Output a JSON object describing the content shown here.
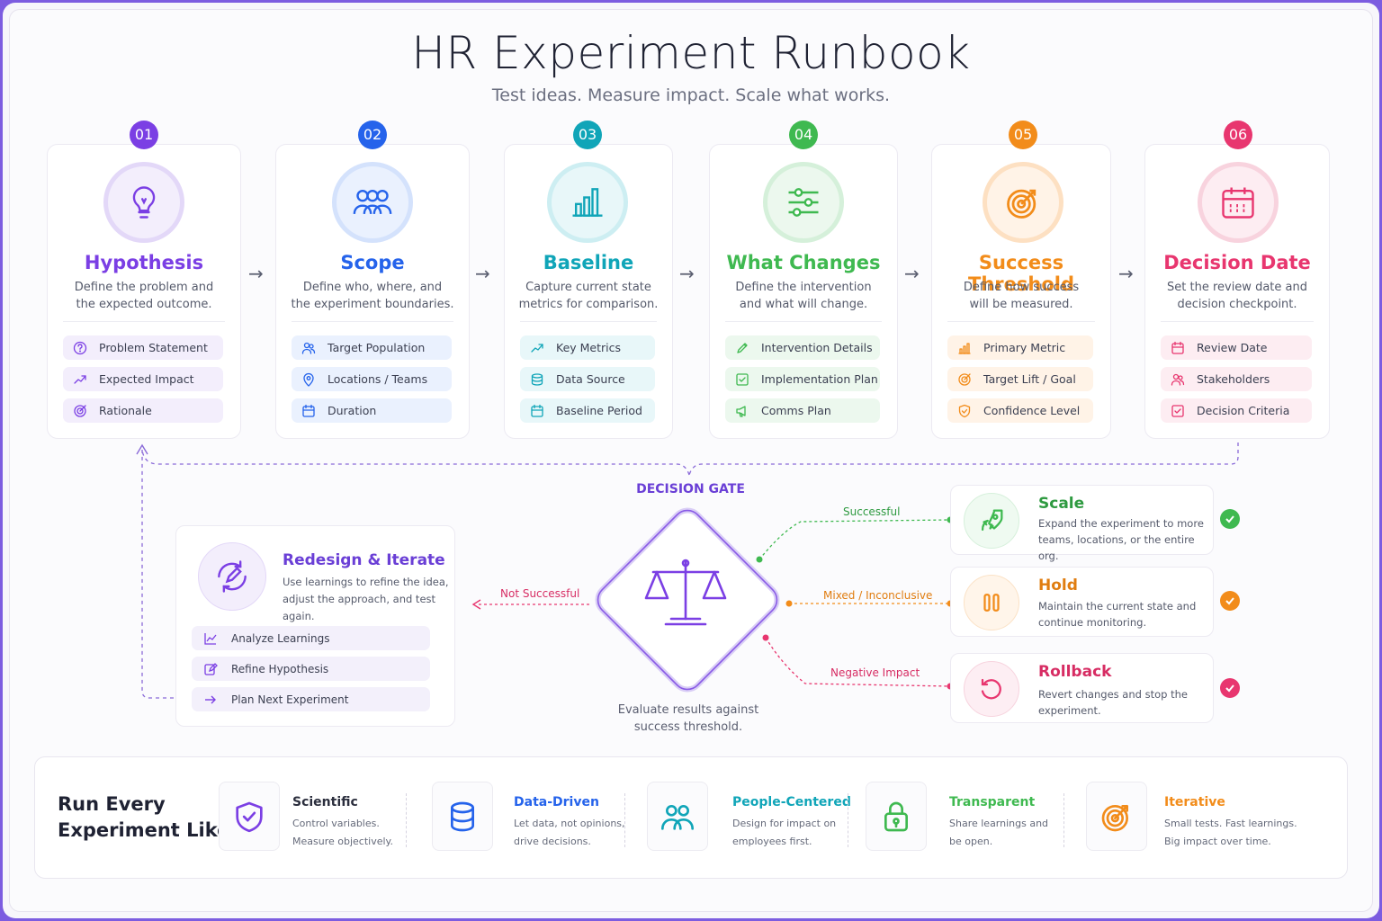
{
  "header": {
    "title": "HR Experiment Runbook",
    "subtitle": "Test ideas. Measure impact. Scale what works."
  },
  "steps": [
    {
      "num": "01",
      "title": "Hypothesis",
      "desc1": "Define the problem and",
      "desc2": "the expected outcome.",
      "color": "#7b3fe4",
      "items": [
        "Problem Statement",
        "Expected Impact",
        "Rationale"
      ]
    },
    {
      "num": "02",
      "title": "Scope",
      "desc1": "Define who, where, and",
      "desc2": "the experiment boundaries.",
      "color": "#2563eb",
      "items": [
        "Target Population",
        "Locations / Teams",
        "Duration"
      ]
    },
    {
      "num": "03",
      "title": "Baseline",
      "desc1": "Capture current state",
      "desc2": "metrics for comparison.",
      "color": "#10a5b8",
      "items": [
        "Key Metrics",
        "Data Source",
        "Baseline Period"
      ]
    },
    {
      "num": "04",
      "title": "What Changes",
      "desc1": "Define the intervention",
      "desc2": "and what will change.",
      "color": "#3fb950",
      "items": [
        "Intervention Details",
        "Implementation Plan",
        "Comms Plan"
      ]
    },
    {
      "num": "05",
      "title": "Success Threshold",
      "desc1": "Define how success",
      "desc2": "will be measured.",
      "color": "#f28c1a",
      "items": [
        "Primary Metric",
        "Target Lift / Goal",
        "Confidence Level"
      ]
    },
    {
      "num": "06",
      "title": "Decision Date",
      "desc1": "Set the review date and",
      "desc2": "decision checkpoint.",
      "color": "#e8366f",
      "items": [
        "Review Date",
        "Stakeholders",
        "Decision Criteria"
      ]
    }
  ],
  "gate": {
    "label": "DECISION GATE",
    "caption1": "Evaluate results against",
    "caption2": "success threshold."
  },
  "edges": {
    "successful": "Successful",
    "mixed": "Mixed / Inconclusive",
    "negative": "Negative Impact",
    "not_successful": "Not Successful"
  },
  "outcomes": [
    {
      "title": "Scale",
      "desc1": "Expand the experiment to more",
      "desc2": "teams, locations, or the entire org.",
      "color": "#3fb950"
    },
    {
      "title": "Hold",
      "desc1": "Maintain the current state and",
      "desc2": "continue monitoring.",
      "color": "#f28c1a"
    },
    {
      "title": "Rollback",
      "desc1": "Revert changes and stop the",
      "desc2": "experiment.",
      "color": "#e8366f"
    }
  ],
  "redesign": {
    "title": "Redesign & Iterate",
    "desc1": "Use learnings to refine the idea,",
    "desc2": "adjust the approach, and test again.",
    "items": [
      "Analyze Learnings",
      "Refine Hypothesis",
      "Plan Next Experiment"
    ]
  },
  "footer": {
    "title1": "Run Every",
    "title2": "Experiment Like",
    "principles": [
      {
        "title": "Scientific",
        "desc1": "Control variables.",
        "desc2": "Measure objectively.",
        "color": "#7b3fe4"
      },
      {
        "title": "Data-Driven",
        "desc1": "Let data, not opinions,",
        "desc2": "drive decisions.",
        "color": "#2563eb"
      },
      {
        "title": "People-Centered",
        "desc1": "Design for impact on",
        "desc2": "employees first.",
        "color": "#10a5b8"
      },
      {
        "title": "Transparent",
        "desc1": "Share learnings and",
        "desc2": "be open.",
        "color": "#3fb950"
      },
      {
        "title": "Iterative",
        "desc1": "Small tests. Fast learnings.",
        "desc2": "Big impact over time.",
        "color": "#f28c1a"
      }
    ]
  }
}
